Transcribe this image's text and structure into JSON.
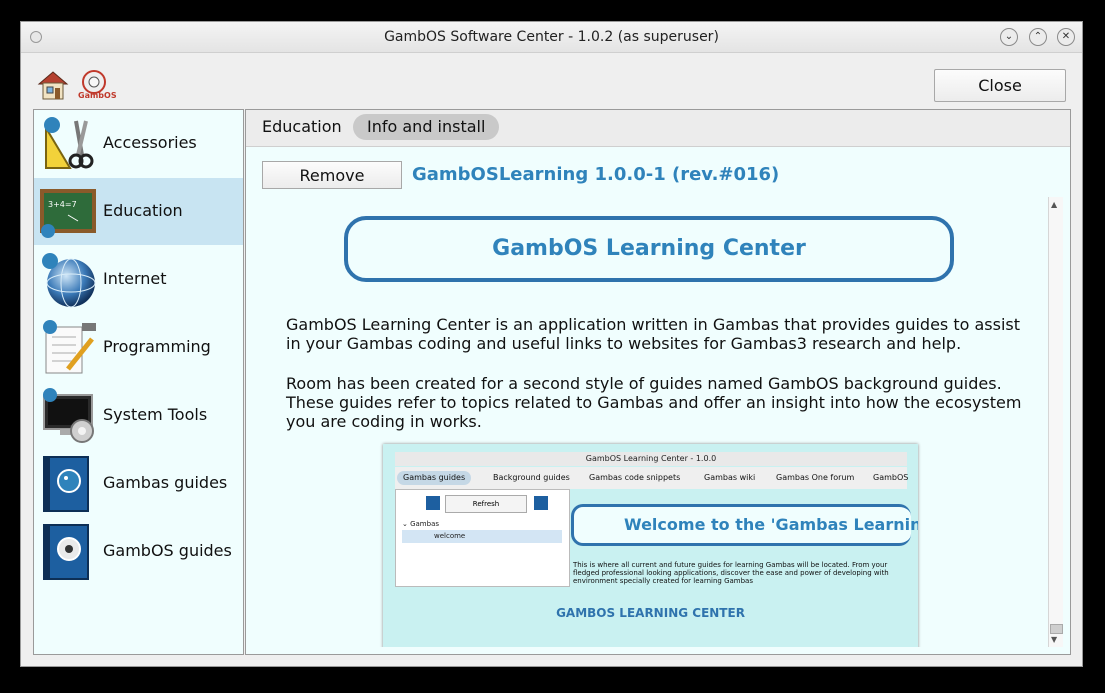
{
  "window": {
    "title": "GambOS Software Center - 1.0.2 (as superuser)",
    "controls": [
      "⌄",
      "⌃",
      "✕"
    ]
  },
  "toolbar": {
    "home_icon": "home-icon",
    "gambos_icon": "gambos-logo-icon",
    "gambos_logo_text": "GambOS",
    "close_label": "Close"
  },
  "sidebar": {
    "items": [
      {
        "label": "Accessories",
        "icon": "accessories-icon"
      },
      {
        "label": "Education",
        "icon": "education-icon",
        "selected": true
      },
      {
        "label": "Internet",
        "icon": "internet-icon"
      },
      {
        "label": "Programming",
        "icon": "programming-icon"
      },
      {
        "label": "System Tools",
        "icon": "system-tools-icon"
      },
      {
        "label": "Gambas guides",
        "icon": "gambas-guides-icon"
      },
      {
        "label": "GambOS guides",
        "icon": "gambos-guides-icon"
      }
    ]
  },
  "main": {
    "tabs": [
      {
        "label": "Education",
        "active": false
      },
      {
        "label": "Info and install",
        "active": true
      }
    ],
    "remove_label": "Remove",
    "package_title": "GambOSLearning 1.0.0-1 (rev.#016)",
    "banner_title": "GambOS Learning Center",
    "paragraph1": "GambOS Learning Center is an application written in Gambas that provides guides to assist in your Gambas coding and useful links to websites for Gambas3 research and help.",
    "paragraph2": "Room has been created for a second style of guides named GambOS background guides. These guides refer to topics related to Gambas and offer an insight into how the ecosystem you are coding in works.",
    "screenshot": {
      "window_title": "GambOS Learning Center - 1.0.0",
      "tabs": [
        "Gambas guides",
        "Background guides",
        "Gambas code snippets",
        "Gambas wiki",
        "Gambas One forum",
        "GambOS"
      ],
      "refresh_label": "Refresh",
      "tree_root": "Gambas",
      "tree_item": "welcome",
      "welcome_heading": "Welcome to the 'Gambas Learning",
      "body_line1": "This is where all current and future guides for learning Gambas will be located. From your",
      "body_line2": "fledged professional looking applications, discover the ease and power of developing with",
      "body_line3": "environment specially created for learning Gambas",
      "caption": "GAMBOS LEARNING CENTER"
    }
  },
  "colors": {
    "accent": "#2f83bb",
    "banner_border": "#2f73ad",
    "selection": "#c8e4f2",
    "content_bg": "#f0fefe",
    "screenshot_bg": "#c9f1f1"
  }
}
